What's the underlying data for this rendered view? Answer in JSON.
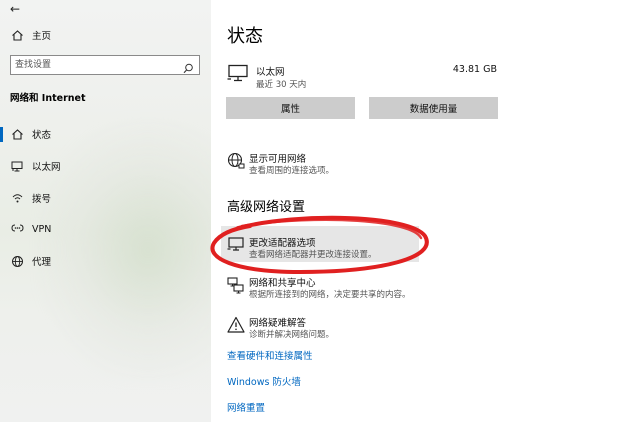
{
  "sidebar": {
    "back_glyph": "←",
    "home_label": "主页",
    "search_placeholder": "查找设置",
    "section_title": "网络和 Internet",
    "items": [
      {
        "label": "状态",
        "icon": "home-status-icon"
      },
      {
        "label": "以太网",
        "icon": "ethernet-icon"
      },
      {
        "label": "拨号",
        "icon": "dialup-icon"
      },
      {
        "label": "VPN",
        "icon": "vpn-icon"
      },
      {
        "label": "代理",
        "icon": "proxy-globe-icon"
      }
    ],
    "active_index": 0
  },
  "main": {
    "title": "状态",
    "ethernet": {
      "name": "以太网",
      "subtitle": "最近 30 天内",
      "usage": "43.81 GB"
    },
    "buttons": {
      "properties": "属性",
      "data_usage": "数据使用量"
    },
    "show_networks": {
      "title": "显示可用网络",
      "desc": "查看周围的连接选项。"
    },
    "advanced_title": "高级网络设置",
    "adapter": {
      "title": "更改适配器选项",
      "desc": "查看网络适配器并更改连接设置。"
    },
    "sharing": {
      "title": "网络和共享中心",
      "desc": "根据所连接到的网络，决定要共享的内容。"
    },
    "troubleshoot": {
      "title": "网络疑难解答",
      "desc": "诊断并解决网络问题。"
    },
    "links": {
      "hardware": "查看硬件和连接属性",
      "firewall": "Windows 防火墙",
      "reset": "网络重置"
    }
  },
  "colors": {
    "accent": "#0067c0",
    "annotation_red": "#e02020",
    "button_gray": "#cccccc"
  }
}
